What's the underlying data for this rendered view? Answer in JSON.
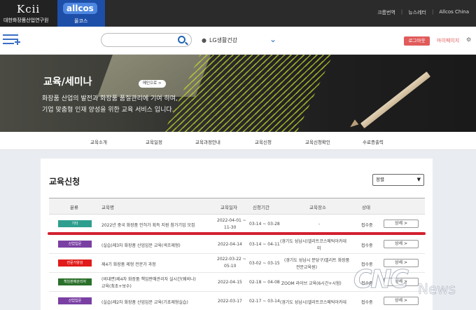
{
  "topbar": {
    "logo_text": "Kcii",
    "institute_name": "대한화장품산업연구원",
    "allcos_logo": "allcos",
    "allcos_sub": "올코스",
    "links": [
      "크롬번역",
      "뉴스레터",
      "Allcos China"
    ]
  },
  "nav": {
    "search_placeholder": "",
    "company": "LG생활건강",
    "login": "로그아웃",
    "mypage": "마이페이지"
  },
  "banner": {
    "title": "교육/세미나",
    "main_button": "메인으로 >",
    "desc_line1": "화장품 산업의 발전과 화장품 품질관리에 기여 하며,",
    "desc_line2": "기업 맞춤형 인재 양성을 위한 교육 서비스 입니다."
  },
  "tabs": [
    "교육소개",
    "교육일정",
    "교육과정안내",
    "교육신청",
    "교육신청확인",
    "수료증출력"
  ],
  "main": {
    "title": "교육신청",
    "sort_value": "정렬",
    "columns": [
      "분류",
      "교육명",
      "교육일자",
      "신청기간",
      "교육장소",
      "상태"
    ],
    "detail_label": "상세 >",
    "rows": [
      {
        "category": "기타",
        "name": "2022년 중국 화장품 인허가 획득 지원 참가기업 모집",
        "date1": "2022-04-01 ~",
        "date2": "11-30",
        "period": "03-14 ~ 03-28",
        "place1": "-",
        "place2": "",
        "status": "접수중"
      },
      {
        "category": "산업입문",
        "name": "(실습)제3차 화장품 산업입문 교육(색조제형)",
        "date1": "2022-04-14",
        "date2": "",
        "period": "03-14 ~ 04-11",
        "place1": "(경기도 성남시)엘리트코스메틱아카데",
        "place2": "미",
        "status": "접수중"
      },
      {
        "category": "전문가양성",
        "name": "제4기 화장품 제형 전문가 과정",
        "date1": "2022-03-22 ~",
        "date2": "05-10",
        "period": "03-02 ~ 03-15",
        "place1": "(경기도 성남시 분당구)엘리트 화장품",
        "place2": "전문교육원)",
        "status": "접수중"
      },
      {
        "category": "책임판매관리자",
        "name": "(비대면)제4차 화장품 책임판매관리자 실시간(웨비나)",
        "name2": "교육(최초+보수)",
        "date1": "2022-04-15",
        "date2": "",
        "period": "02-18 ~ 04-08",
        "place1": "ZOOM 라이브 교육(6시간+시험)",
        "place2": "",
        "status": "접수중"
      },
      {
        "category": "산업입문",
        "name": "(실습)제2차 화장품 산업입문 교육(기초제형실습)",
        "date1": "2022-03-17",
        "date2": "",
        "period": "02-17 ~ 03-14",
        "place1": "(경기도 성남시)엘리트코스메틱아카데",
        "place2": "",
        "status": "접수중"
      }
    ]
  },
  "watermark": {
    "brand": "CNC",
    "news": "News"
  },
  "colors": {
    "badge_etc": "#2e9e8f",
    "badge_intro": "#7a3fa3",
    "badge_expert": "#e11b1b",
    "badge_manager": "#2a6f2a",
    "accent": "#1e64b4",
    "underline": "#d32030"
  }
}
